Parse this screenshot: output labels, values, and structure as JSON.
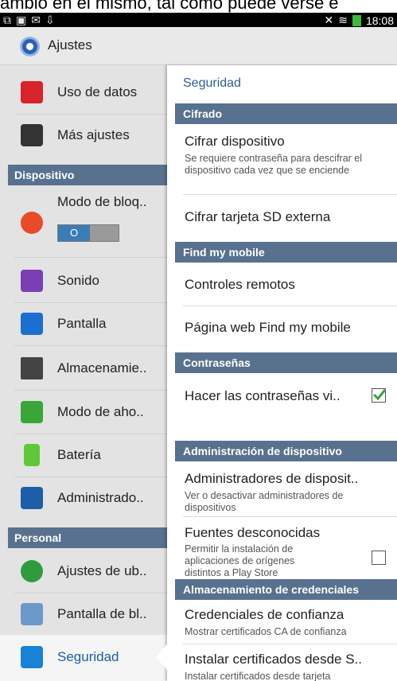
{
  "caption": "ambio en el mismo, tal como puede verse e",
  "status_bar": {
    "icons": [
      "notification-icon",
      "image-icon",
      "mail-icon",
      "download-icon"
    ],
    "time": "18:08"
  },
  "action_bar": {
    "title": "Ajustes"
  },
  "left_pane": {
    "items": [
      {
        "label": "Uso de datos"
      },
      {
        "label": "Más ajustes"
      },
      {
        "label": "Modo de bloq.."
      },
      {
        "label": "Sonido"
      },
      {
        "label": "Pantalla"
      },
      {
        "label": "Almacenamie.."
      },
      {
        "label": "Modo de aho.."
      },
      {
        "label": "Batería"
      },
      {
        "label": "Administrado.."
      },
      {
        "label": "Ajustes de ub.."
      },
      {
        "label": "Pantalla de bl.."
      },
      {
        "label": "Seguridad"
      }
    ],
    "headers": [
      "Dispositivo",
      "Personal"
    ],
    "toggle_label": "O"
  },
  "right_pane": {
    "page_title": "Seguridad",
    "sections": [
      {
        "header": "Cifrado"
      },
      {
        "header": "Find my mobile"
      },
      {
        "header": "Contraseñas"
      },
      {
        "header": "Administración de dispositivo"
      },
      {
        "header": "Almacenamiento de credenciales"
      }
    ],
    "items": {
      "cifrar_dispositivo": {
        "title": "Cifrar dispositivo",
        "subtitle": "Se requiere contraseña para descifrar el dispositivo cada vez que se enciende"
      },
      "cifrar_sd": {
        "title": "Cifrar tarjeta SD externa"
      },
      "controles_remotos": {
        "title": "Controles remotos"
      },
      "pagina_web": {
        "title": "Página web Find my mobile"
      },
      "hacer_contrasenas": {
        "title": "Hacer las contraseñas vi..",
        "checked": true
      },
      "administradores": {
        "title": "Administradores de disposit..",
        "subtitle": "Ver o desactivar administradores de dispositivos"
      },
      "fuentes": {
        "title": "Fuentes desconocidas",
        "subtitle": "Permitir la instalación de aplicaciones de orígenes distintos a Play Store",
        "checked": false
      },
      "credenciales": {
        "title": "Credenciales de confianza",
        "subtitle": "Mostrar certificados CA de confianza"
      },
      "instalar": {
        "title": "Instalar certificados desde S..",
        "subtitle": "Instalar certificados desde tarjeta"
      }
    }
  },
  "colors": {
    "accent": "#2d5e97",
    "section_header": "#58718e",
    "check": "#3aa63a"
  }
}
